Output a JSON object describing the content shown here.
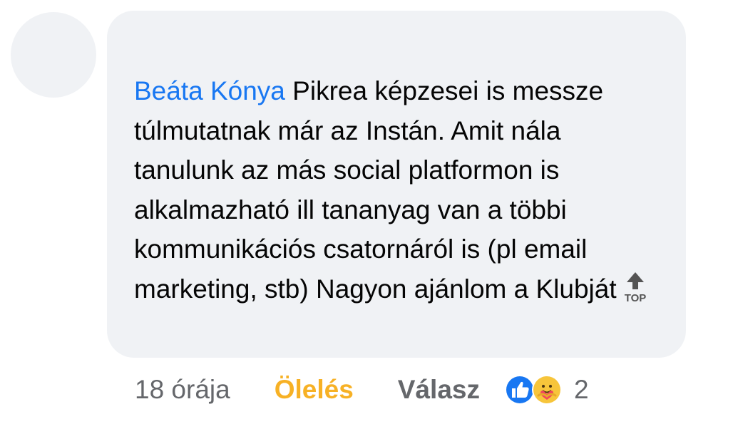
{
  "comment": {
    "author": "Beáta Kónya",
    "text": "Pikrea képzesei is messze túlmutatnak már az Instán. Amit nála tanulunk az más social platformon is alkalmazható ill tananyag van a többi kommunikációs csatornáról is (pl email marketing, stb) Nagyon ajánlom a Klubját",
    "emoji_label": "TOP",
    "emoji_icon": "top-arrow-icon"
  },
  "actions": {
    "time": "18 órája",
    "reaction_label": "Ölelés",
    "reply_label": "Válasz",
    "reaction_count": "2",
    "reaction_icons": [
      "like-icon",
      "care-icon"
    ]
  },
  "colors": {
    "author": "#1877f2",
    "bubble": "#f0f2f5",
    "reaction_active": "#f7b125",
    "muted": "#65676b",
    "text": "#050505"
  }
}
